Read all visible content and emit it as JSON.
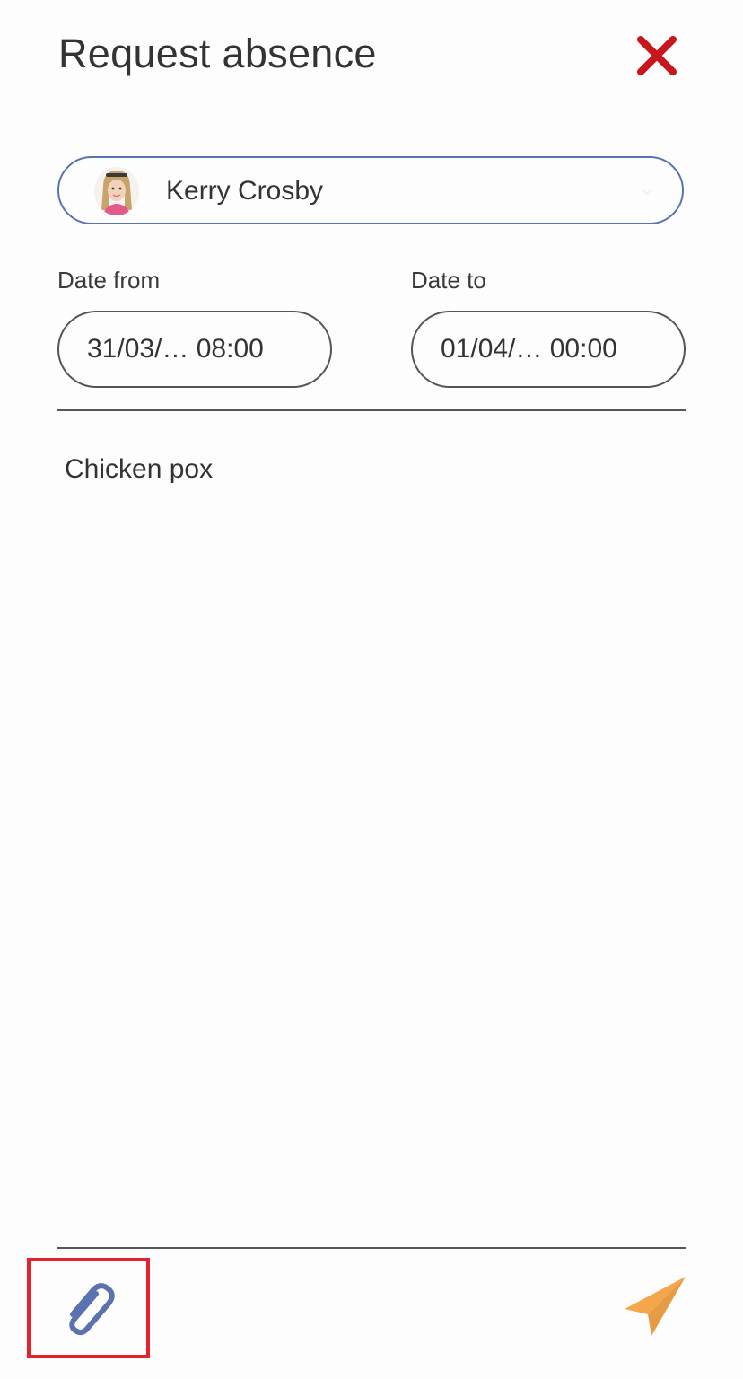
{
  "header": {
    "title": "Request absence",
    "close_icon": "close-icon",
    "close_color": "#c8161d"
  },
  "child": {
    "name": "Kerry Crosby",
    "avatar_icon": "child-photo",
    "border_color": "#5b72b0"
  },
  "dates": {
    "from_label": "Date from",
    "from_value": "31/03/… 08:00",
    "to_label": "Date to",
    "to_value": "01/04/… 00:00"
  },
  "reason": {
    "text": "Chicken pox"
  },
  "footer": {
    "attach_icon": "paperclip-icon",
    "attach_color": "#5b72b0",
    "send_icon": "send-icon",
    "send_color": "#f5a64a",
    "highlight_color": "#e6232a"
  }
}
